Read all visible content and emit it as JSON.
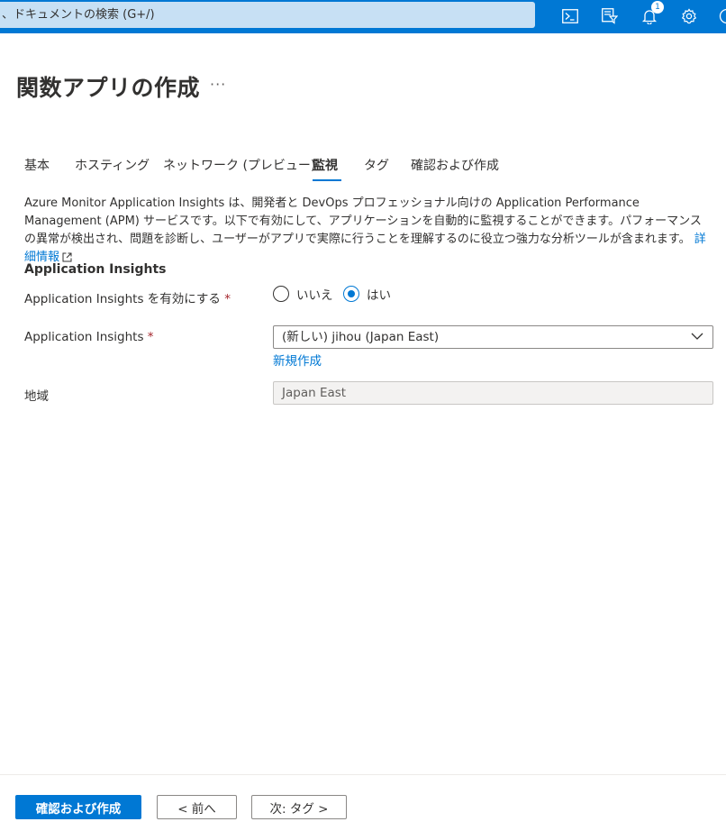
{
  "topbar": {
    "search_placeholder": "、ドキュメントの検索 (G+/)",
    "notification_count": "1",
    "icons": [
      "cloud-shell-icon",
      "directory-filter-icon",
      "notifications-icon",
      "settings-icon",
      "help-icon"
    ]
  },
  "page": {
    "title": "関数アプリの作成",
    "more": "···"
  },
  "tabs": [
    {
      "label": "基本"
    },
    {
      "label": "ホスティング"
    },
    {
      "label": "ネットワーク (プレビュー)"
    },
    {
      "label": "監視",
      "active": true
    },
    {
      "label": "タグ"
    },
    {
      "label": "確認および作成"
    }
  ],
  "description": {
    "text": "Azure Monitor Application Insights は、開発者と DevOps プロフェッショナル向けの Application Performance Management (APM) サービスです。以下で有効にして、アプリケーションを自動的に監視することができます。パフォーマンスの異常が検出され、問題を診断し、ユーザーがアプリで実際に行うことを理解するのに役立つ強力な分析ツールが含まれます。",
    "link": "詳細情報"
  },
  "section": {
    "title": "Application Insights",
    "enable_label": "Application Insights を有効にする",
    "required_mark": "*",
    "radio_no": "いいえ",
    "radio_yes": "はい",
    "radio_selected": "はい",
    "ai_label": "Application Insights",
    "ai_value": "(新しい) jihou (Japan East)",
    "create_new": "新規作成",
    "region_label": "地域",
    "region_value": "Japan East"
  },
  "footer": {
    "review_button": "確認および作成",
    "prev_button": "< 前へ",
    "next_button": "次: タグ >"
  },
  "colors": {
    "accent": "#0078d4",
    "required": "#a4262c",
    "search_bg": "#c7e0f4"
  }
}
